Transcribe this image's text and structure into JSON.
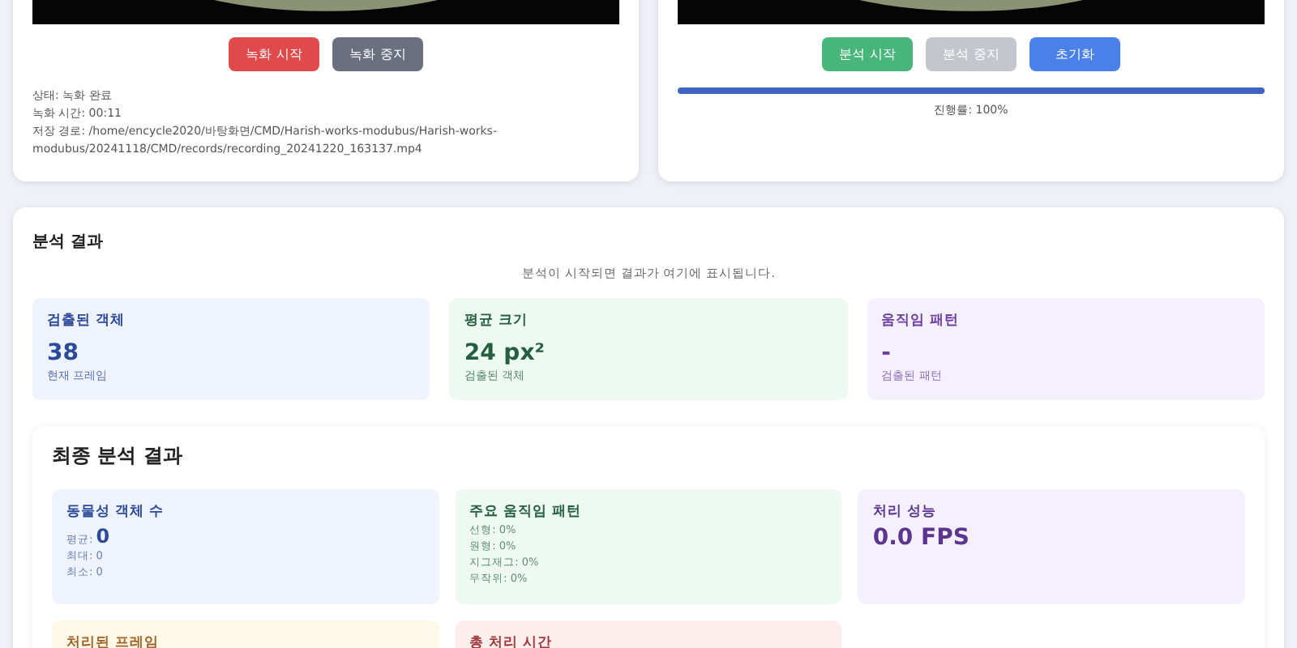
{
  "recorder": {
    "buttons": [
      {
        "label": "녹화 시작",
        "kind": "record",
        "disabled": false
      },
      {
        "label": "녹화 중지",
        "kind": "stop",
        "disabled": false
      }
    ],
    "info": [
      "상태: 녹화 완료",
      "녹화 시간: 00:11",
      "저장 경로: /home/encycle2020/바탕화면/CMD/Harish-works-modubus/Harish-works-modubus/20241118/CMD/records/recording_20241220_163137.mp4"
    ]
  },
  "analyzer": {
    "buttons": [
      {
        "label": "분석 시작",
        "kind": "start",
        "disabled": false
      },
      {
        "label": "분석 중지",
        "kind": "stop",
        "disabled": true
      },
      {
        "label": "초기화",
        "kind": "reset",
        "disabled": false
      }
    ],
    "progress": {
      "level": 1,
      "label": "진행률: 100%"
    }
  },
  "results": {
    "title": "분석 결과",
    "hint": "분석이 시작되면 결과가 여기에 표시됩니다.",
    "metrics": [
      {
        "title": "검출된 객체",
        "value": "38",
        "caption": "현재 프레임",
        "color": "#2c4a9a"
      },
      {
        "title": "평균 크기",
        "value": "24 px²",
        "caption": "검출된 객체",
        "color": "#24603f"
      },
      {
        "title": "움직임 패턴",
        "value": "-",
        "caption": "검출된 패턴",
        "color": "#6b3fa0"
      }
    ],
    "final": {
      "title": "최종 분석 결과",
      "cards": [
        {
          "kind": "count",
          "title": "동물성 객체 수",
          "color": "#2c4a9a",
          "avg_label": "평균:",
          "avg": "0",
          "lines": [
            "최대: 0",
            "최소: 0"
          ]
        },
        {
          "kind": "list",
          "title": "주요 움직임 패턴",
          "color": "#24603f",
          "lines": [
            "선형: 0%",
            "원형: 0%",
            "지그재그: 0%",
            "무작위: 0%"
          ]
        },
        {
          "kind": "value",
          "title": "처리 성능",
          "color": "#5b3590",
          "value": "0.0 FPS"
        },
        {
          "kind": "value",
          "title": "처리된 프레임",
          "color": "#a0652a"
        },
        {
          "kind": "value",
          "title": "총 처리 시간",
          "color": "#a03a3a"
        }
      ]
    }
  }
}
